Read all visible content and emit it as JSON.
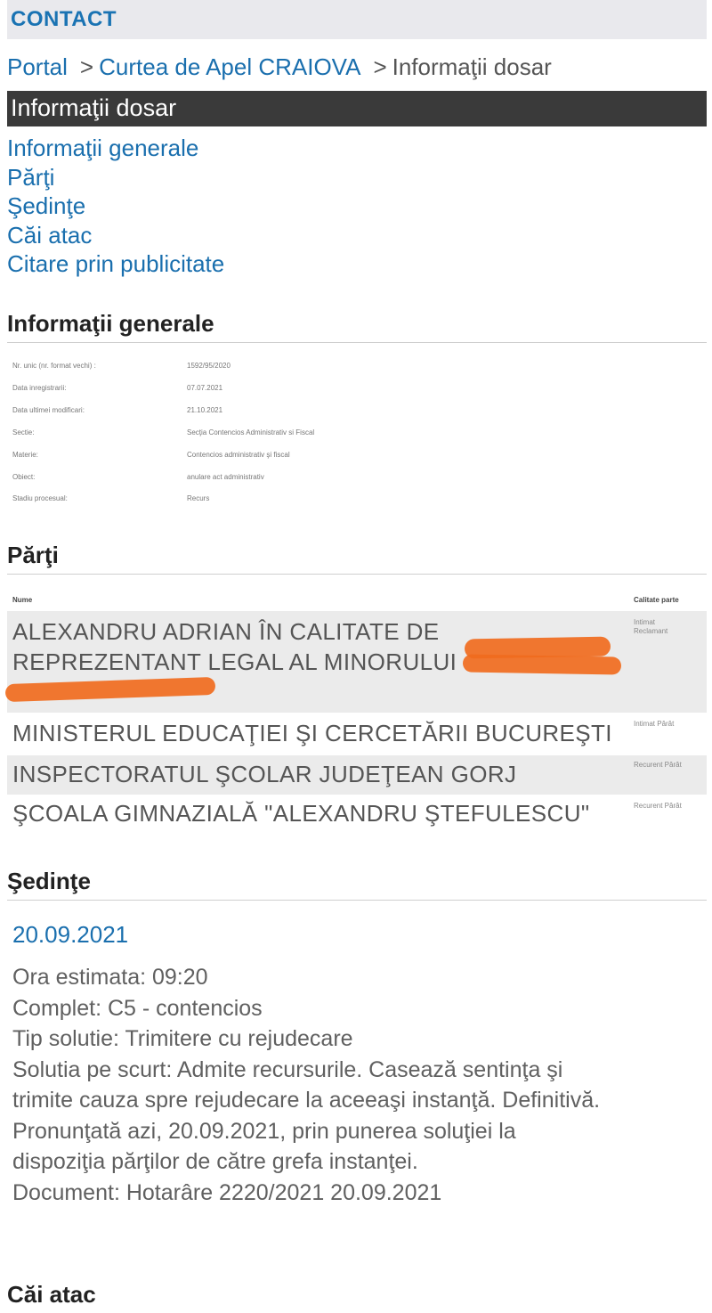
{
  "topbar": {
    "contact": "CONTACT"
  },
  "breadcrumb": {
    "portal": "Portal",
    "sep1": ">",
    "court": "Curtea de Apel CRAIOVA",
    "sep2": ">",
    "current": "Informaţii dosar"
  },
  "header_bar": {
    "title": "Informaţii dosar"
  },
  "nav": {
    "items": [
      {
        "label": "Informaţii generale"
      },
      {
        "label": "Părţi"
      },
      {
        "label": "Şedinţe"
      },
      {
        "label": "Căi atac"
      },
      {
        "label": "Citare prin publicitate"
      }
    ]
  },
  "general_info": {
    "title": "Informaţii generale",
    "rows": [
      {
        "label": "Nr. unic (nr. format vechi) :",
        "value": "1592/95/2020"
      },
      {
        "label": "Data inregistrarii:",
        "value": "07.07.2021"
      },
      {
        "label": "Data ultimei modificari:",
        "value": "21.10.2021"
      },
      {
        "label": "Sectie:",
        "value": "Secţia Contencios Administrativ si Fiscal"
      },
      {
        "label": "Materie:",
        "value": "Contencios administrativ şi fiscal"
      },
      {
        "label": "Obiect:",
        "value": "anulare act administrativ"
      },
      {
        "label": "Stadiu procesual:",
        "value": "Recurs"
      }
    ]
  },
  "parti": {
    "title": "Părţi",
    "col_name": "Nume",
    "col_role": "Calitate parte",
    "rows": [
      {
        "name_line1": "ALEXANDRU ADRIAN ÎN CALITATE DE",
        "name_line2": "REPREZENTANT LEGAL AL MINORULUI",
        "role_line1": "Intimat",
        "role_line2": "Reclamant"
      },
      {
        "name": "MINISTERUL EDUCAŢIEI ŞI CERCETĂRII BUCUREŞTI",
        "role": "Intimat Pârât"
      },
      {
        "name": "INSPECTORATUL ŞCOLAR JUDEŢEAN GORJ",
        "role": "Recurent Pârât"
      },
      {
        "name": "ŞCOALA GIMNAZIALĂ \"ALEXANDRU ŞTEFULESCU\"",
        "role": "Recurent Pârât"
      }
    ]
  },
  "sedinte": {
    "title": "Şedinţe",
    "date": "20.09.2021",
    "lines": [
      "Ora estimata: 09:20",
      "Complet: C5 - contencios",
      "Tip solutie: Trimitere cu rejudecare",
      "Solutia pe scurt: Admite recursurile. Casează sentinţa şi",
      "trimite cauza spre rejudecare la aceeaşi instanţă. Definitivă.",
      "Pronunţată azi, 20.09.2021, prin punerea soluţiei la",
      "dispoziţia părţilor de către grefa instanţei.",
      "Document: Hotarâre  2220/2021  20.09.2021"
    ]
  },
  "cai_atac": {
    "title": "Căi atac"
  },
  "colors": {
    "link": "#1a6fae",
    "header_bar": "#3a3a3a",
    "row_shade": "#ebebeb",
    "redaction": "#f06b1e"
  }
}
